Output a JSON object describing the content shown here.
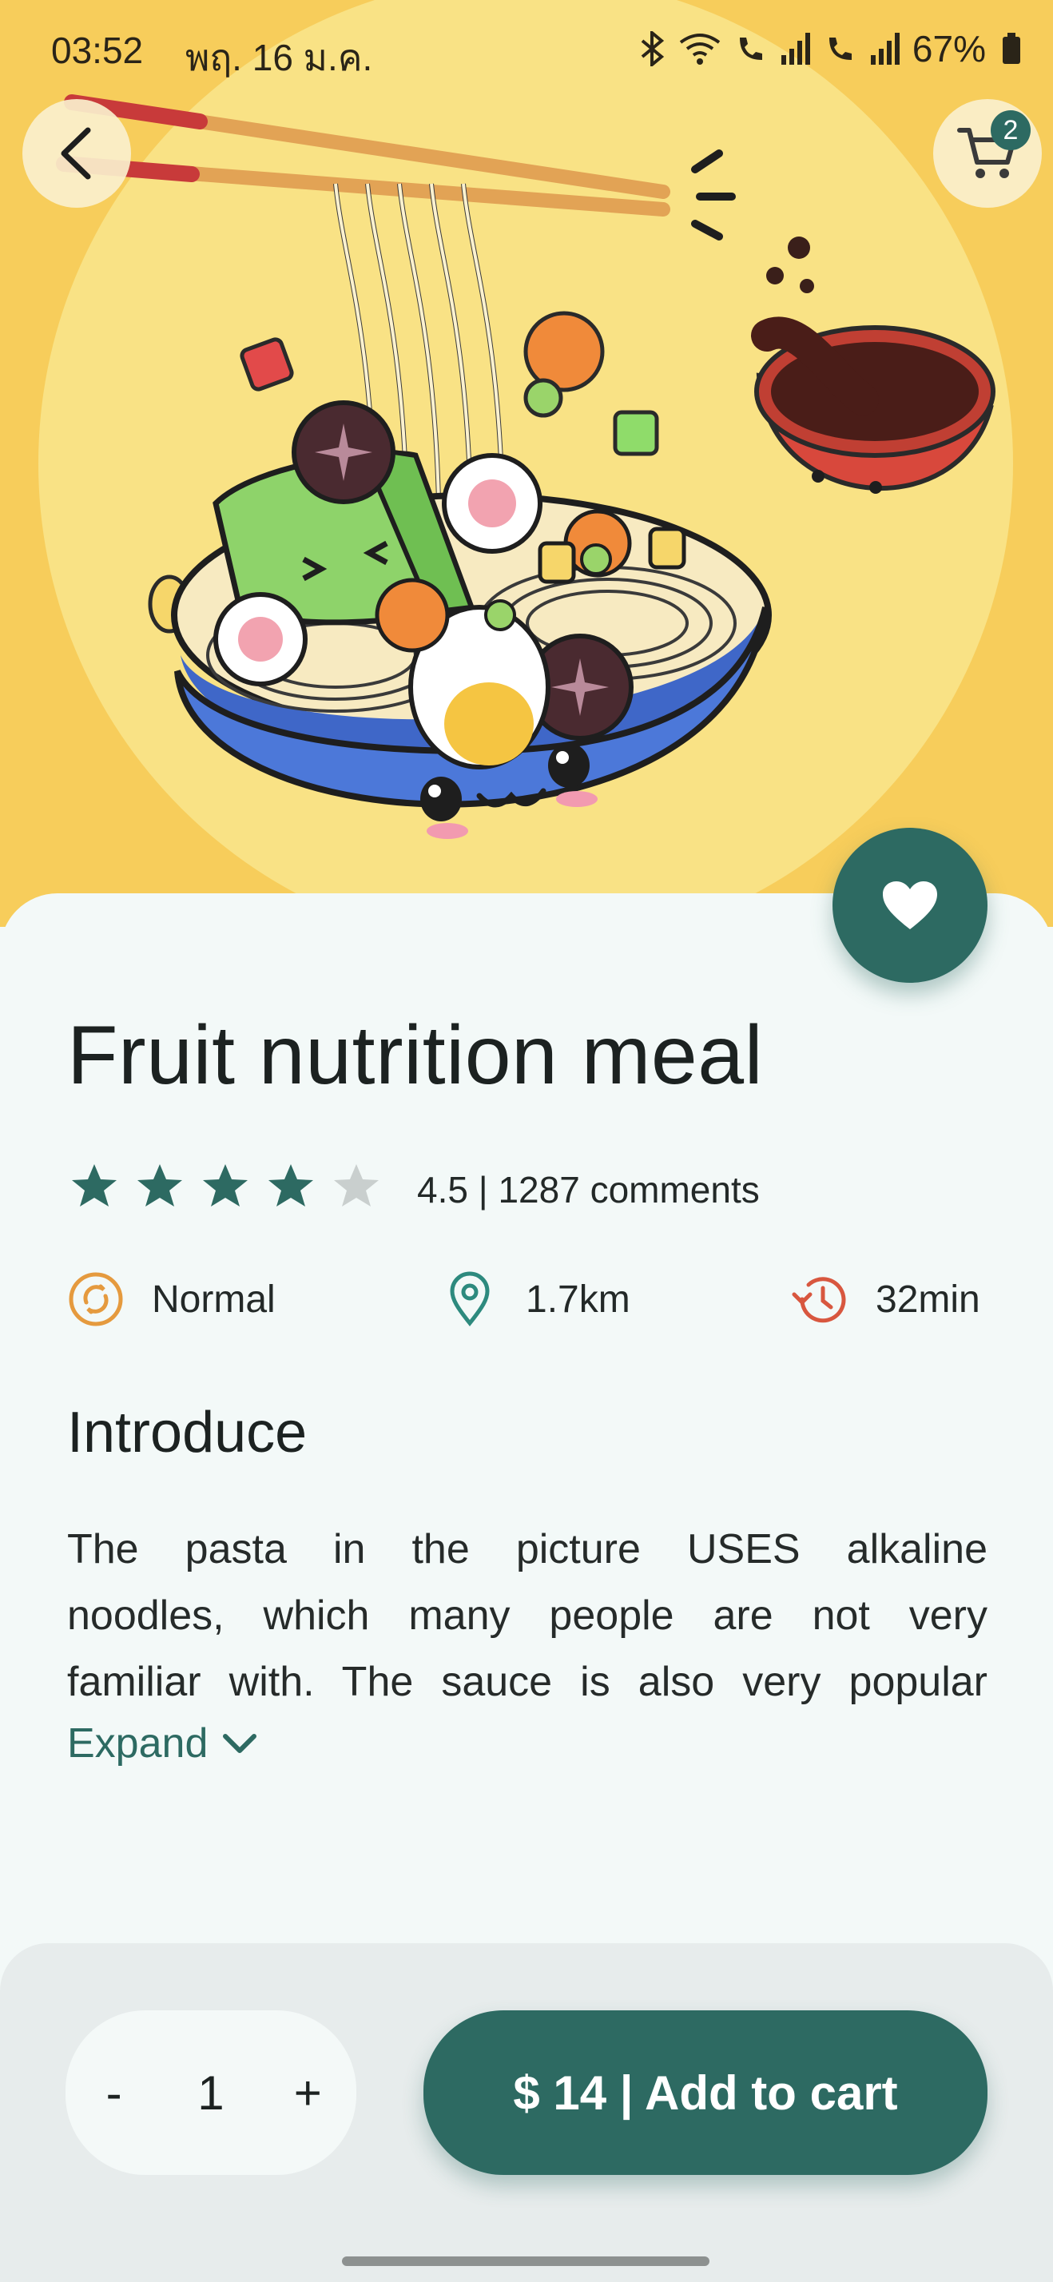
{
  "status_bar": {
    "time": "03:52",
    "date": "พฤ. 16 ม.ค.",
    "battery": "67%"
  },
  "header": {
    "cart_badge_count": "2"
  },
  "product": {
    "title": "Fruit nutrition meal",
    "rating_value": 4.5,
    "rating_text": "4.5 | 1287 comments",
    "meta": {
      "spice": "Normal",
      "distance": "1.7km",
      "time": "32min"
    }
  },
  "introduce": {
    "heading": "Introduce",
    "lines": [
      "The pasta in the picture USES alkaline",
      "noodles, which many people are not very",
      "familiar with. The sauce is also very popular"
    ],
    "expand_label": "Expand"
  },
  "cart_bar": {
    "minus_label": "-",
    "quantity": "1",
    "plus_label": "+",
    "add_label": "$ 14 | Add to cart"
  },
  "colors": {
    "accent": "#2d6a62",
    "hero_bg": "#f7cd5b",
    "star_filled": "#2d6a62",
    "star_empty": "#c9cfce",
    "spice_icon": "#e59a3e",
    "location_icon": "#2d8a7e",
    "time_icon": "#d8573f"
  }
}
